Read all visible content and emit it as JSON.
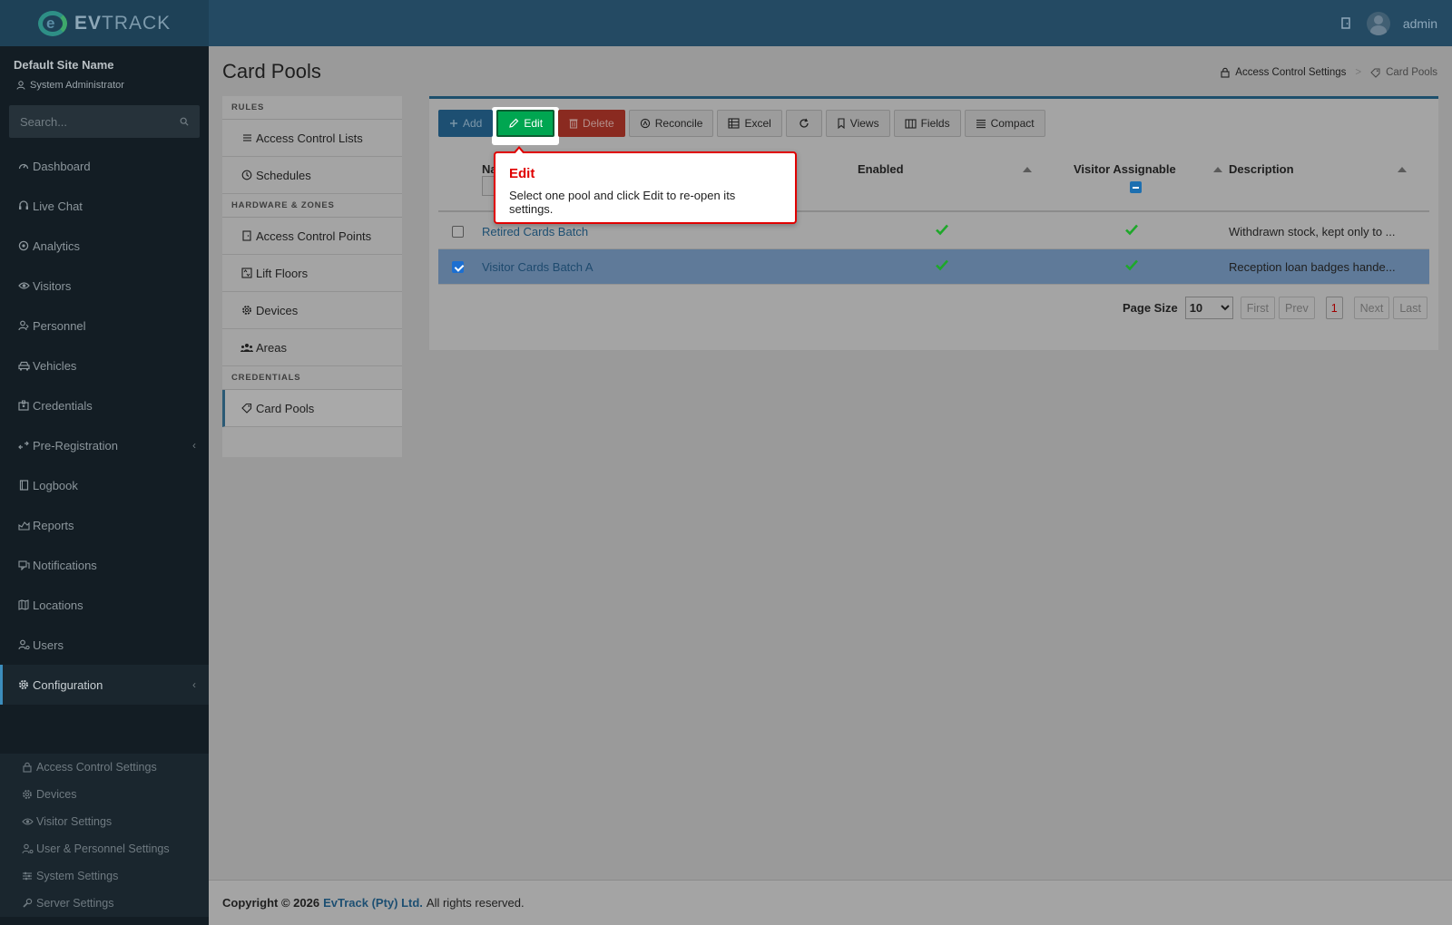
{
  "header": {
    "logo_text_bold": "EV",
    "logo_text_rest": "TRACK",
    "user_name": "admin",
    "icon_door": "door-icon",
    "icon_avatar": "avatar-icon"
  },
  "sidebar": {
    "site_name": "Default Site Name",
    "user_role": "System Administrator",
    "search_placeholder": "Search...",
    "items": [
      {
        "label": "Dashboard",
        "icon": "dashboard-icon"
      },
      {
        "label": "Live Chat",
        "icon": "headset-icon"
      },
      {
        "label": "Analytics",
        "icon": "target-icon"
      },
      {
        "label": "Visitors",
        "icon": "eye-icon"
      },
      {
        "label": "Personnel",
        "icon": "person-icon"
      },
      {
        "label": "Vehicles",
        "icon": "car-icon"
      },
      {
        "label": "Credentials",
        "icon": "badge-icon"
      },
      {
        "label": "Pre-Registration",
        "icon": "arrows-icon"
      },
      {
        "label": "Logbook",
        "icon": "book-icon"
      },
      {
        "label": "Reports",
        "icon": "chart-icon"
      },
      {
        "label": "Notifications",
        "icon": "chat-icon"
      },
      {
        "label": "Locations",
        "icon": "map-icon"
      },
      {
        "label": "Users",
        "icon": "user-gear-icon"
      },
      {
        "label": "Configuration",
        "icon": "gear-icon"
      }
    ],
    "sub_items": [
      {
        "label": "Access Control Settings",
        "icon": "lock-icon"
      },
      {
        "label": "Devices",
        "icon": "cog-icon"
      },
      {
        "label": "Visitor Settings",
        "icon": "eye-icon"
      },
      {
        "label": "User & Personnel Settings",
        "icon": "user-gear-icon"
      },
      {
        "label": "System Settings",
        "icon": "sliders-icon"
      },
      {
        "label": "Server Settings",
        "icon": "wrench-icon"
      }
    ]
  },
  "page": {
    "title": "Card Pools",
    "breadcrumb": {
      "parent": "Access Control Settings",
      "separator": ">",
      "current": "Card Pools"
    }
  },
  "settings_menu": {
    "sections": [
      {
        "title": "RULES",
        "items": [
          {
            "label": "Access Control Lists",
            "icon": "list-icon"
          },
          {
            "label": "Schedules",
            "icon": "clock-icon"
          }
        ]
      },
      {
        "title": "HARDWARE & ZONES",
        "items": [
          {
            "label": "Access Control Points",
            "icon": "door-icon"
          },
          {
            "label": "Lift Floors",
            "icon": "elevator-icon"
          },
          {
            "label": "Devices",
            "icon": "cog-icon"
          },
          {
            "label": "Areas",
            "icon": "people-icon"
          }
        ]
      },
      {
        "title": "CREDENTIALS",
        "items": [
          {
            "label": "Card Pools",
            "icon": "tag-icon"
          }
        ]
      }
    ]
  },
  "toolbar": {
    "add": "Add",
    "edit": "Edit",
    "delete": "Delete",
    "reconcile": "Reconcile",
    "excel": "Excel",
    "views": "Views",
    "fields": "Fields",
    "compact": "Compact"
  },
  "grid": {
    "columns": {
      "name": "Na",
      "enabled": "Enabled",
      "visitor_assignable": "Visitor Assignable",
      "description": "Description"
    },
    "rows": [
      {
        "name": "Retired Cards Batch",
        "enabled": true,
        "visitor_assignable": true,
        "description": "Withdrawn stock, kept only to ...",
        "selected": false
      },
      {
        "name": "Visitor Cards Batch A",
        "enabled": true,
        "visitor_assignable": true,
        "description": "Reception loan badges hande...",
        "selected": true
      }
    ],
    "pager": {
      "label": "Page Size",
      "page_size": "10",
      "first": "First",
      "prev": "Prev",
      "current_page": "1",
      "next": "Next",
      "last": "Last"
    }
  },
  "tooltip": {
    "title": "Edit",
    "body": "Select one pool and click Edit to re-open its settings."
  },
  "footer": {
    "copyright": "Copyright © 2026",
    "company": "EvTrack (Pty) Ltd.",
    "rights": "All rights reserved."
  },
  "colors": {
    "topbar": "#244a63",
    "sidebar": "#131d24",
    "accent": "#1d4f72",
    "edit_green": "#00a651",
    "delete_red": "#8a2a20",
    "tooltip_red": "#e00000",
    "check_green": "#1ea82a"
  }
}
